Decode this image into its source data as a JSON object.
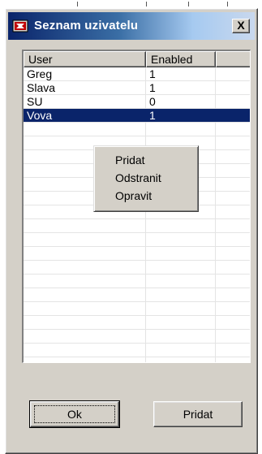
{
  "window": {
    "title": "Seznam uzivatelu",
    "close_label": "X"
  },
  "list": {
    "columns": [
      "User",
      "Enabled"
    ],
    "rows": [
      {
        "user": "Greg",
        "enabled": "1"
      },
      {
        "user": "Slava",
        "enabled": "1"
      },
      {
        "user": "SU",
        "enabled": "0"
      },
      {
        "user": "Vova",
        "enabled": "1",
        "selected": true
      }
    ],
    "selection_color": "#0a246a"
  },
  "context_menu": {
    "items": [
      "Pridat",
      "Odstranit",
      "Opravit"
    ]
  },
  "buttons": {
    "ok_label": "Ok",
    "add_label": "Pridat"
  },
  "icons": {
    "app": "app-icon",
    "close": "close-icon"
  }
}
